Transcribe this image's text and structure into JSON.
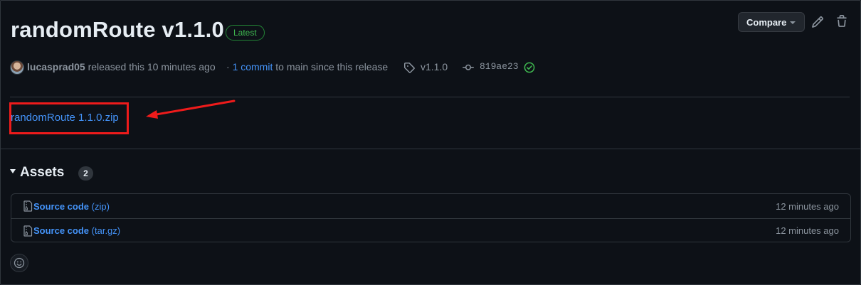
{
  "release": {
    "title": "randomRoute v1.1.0",
    "badge": "Latest",
    "author": "lucasprad05",
    "released_text": "released this 10 minutes ago",
    "commit_prefix": "·",
    "commit_link": "1 commit",
    "commit_suffix": "to main since this release",
    "tag": "v1.1.0",
    "commit_sha": "819ae23",
    "body_link": "randomRoute 1.1.0.zip"
  },
  "toolbar": {
    "compare_label": "Compare",
    "edit_icon": "pencil-icon",
    "delete_icon": "trash-icon"
  },
  "assets": {
    "title": "Assets",
    "count": "2",
    "items": [
      {
        "name": "Source code",
        "ext": "(zip)",
        "time": "12 minutes ago"
      },
      {
        "name": "Source code",
        "ext": "(tar.gz)",
        "time": "12 minutes ago"
      }
    ]
  },
  "colors": {
    "background": "#0d1117",
    "link": "#4493f8",
    "success": "#3fb950",
    "annotation": "#ee1b1b"
  }
}
